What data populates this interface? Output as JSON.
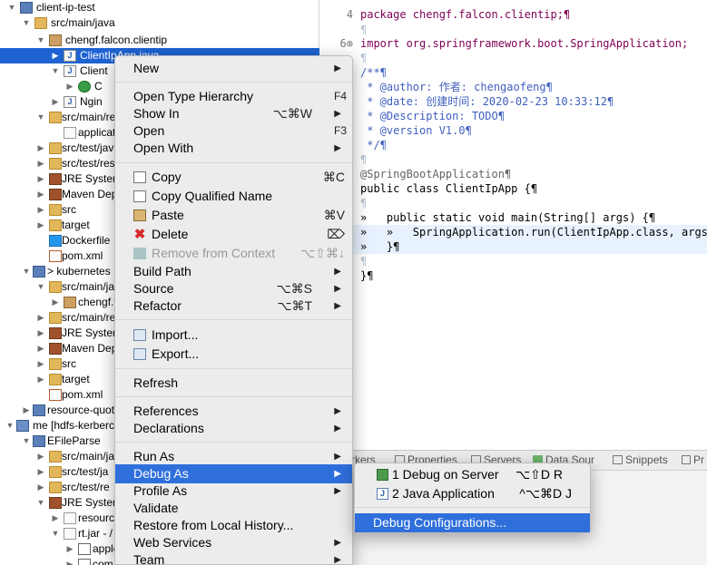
{
  "explorer": {
    "rows": [
      {
        "label": "client-ip-test",
        "expanded": true,
        "icon": "project-icon"
      },
      {
        "label": "src/main/java",
        "expanded": true,
        "icon": "source-folder-icon"
      },
      {
        "label": "chengf.falcon.clientip",
        "expanded": true,
        "icon": "package-icon"
      },
      {
        "label": "ClientIpApp.java",
        "expanded": false,
        "icon": "java-file-icon"
      },
      {
        "label": "Client",
        "expanded": true,
        "icon": "java-file-icon"
      },
      {
        "label": "C",
        "expanded": false,
        "icon": "class-icon"
      },
      {
        "label": "Ngin",
        "expanded": false,
        "icon": "java-file-icon"
      },
      {
        "label": "src/main/re",
        "expanded": true,
        "icon": "source-folder-icon"
      },
      {
        "label": "applicat",
        "expanded": false,
        "icon": "file-icon"
      },
      {
        "label": "src/test/jav",
        "expanded": false,
        "icon": "source-folder-icon"
      },
      {
        "label": "src/test/res",
        "expanded": false,
        "icon": "source-folder-icon"
      },
      {
        "label": "JRE System",
        "expanded": false,
        "icon": "library-icon"
      },
      {
        "label": "Maven Dep",
        "expanded": false,
        "icon": "library-icon"
      },
      {
        "label": "src",
        "expanded": false,
        "icon": "folder-icon"
      },
      {
        "label": "target",
        "expanded": false,
        "icon": "folder-icon"
      },
      {
        "label": "Dockerfile",
        "expanded": false,
        "icon": "docker-icon"
      },
      {
        "label": "pom.xml",
        "expanded": false,
        "icon": "maven-file-icon"
      },
      {
        "label": "> kubernetes",
        "expanded": true,
        "icon": "project-icon"
      },
      {
        "label": "src/main/ja",
        "expanded": true,
        "icon": "source-folder-icon"
      },
      {
        "label": "chengf.f",
        "expanded": false,
        "icon": "package-icon"
      },
      {
        "label": "src/main/re",
        "expanded": false,
        "icon": "source-folder-icon"
      },
      {
        "label": "JRE System",
        "expanded": false,
        "icon": "library-icon"
      },
      {
        "label": "Maven Dep",
        "expanded": false,
        "icon": "library-icon"
      },
      {
        "label": "src",
        "expanded": false,
        "icon": "folder-icon"
      },
      {
        "label": "target",
        "expanded": false,
        "icon": "folder-icon"
      },
      {
        "label": "pom.xml",
        "expanded": false,
        "icon": "maven-file-icon"
      },
      {
        "label": "resource-quot",
        "expanded": false,
        "icon": "project-icon"
      },
      {
        "label": "me [hdfs-kerberc",
        "expanded": true,
        "icon": "working-set-icon"
      },
      {
        "label": "EFileParse",
        "expanded": true,
        "icon": "project-icon"
      },
      {
        "label": "src/main/ja",
        "expanded": false,
        "icon": "source-folder-icon"
      },
      {
        "label": "src/test/ja",
        "expanded": false,
        "icon": "source-folder-icon"
      },
      {
        "label": "src/test/re",
        "expanded": false,
        "icon": "source-folder-icon"
      },
      {
        "label": "JRE System",
        "expanded": true,
        "icon": "library-icon"
      },
      {
        "label": "resource",
        "expanded": false,
        "icon": "jar-icon"
      },
      {
        "label": "rt.jar - /",
        "expanded": true,
        "icon": "jar-icon"
      },
      {
        "label": "apple",
        "expanded": false,
        "icon": "package-icon"
      },
      {
        "label": "com",
        "expanded": false,
        "icon": "package-icon"
      }
    ]
  },
  "editor": {
    "lines": [
      {
        "num": "4",
        "text": "package chengf.falcon.clientip;¶"
      },
      {
        "num": "",
        "text": "¶"
      },
      {
        "num": "6⊕",
        "text": "import org.springframework.boot.SpringApplication;"
      },
      {
        "num": "",
        "text": "¶"
      },
      {
        "num": "⊖",
        "text": "/**¶"
      },
      {
        "num": "",
        "text": " * @author: 作者: chengaofeng¶"
      },
      {
        "num": "",
        "text": " * @date: 创建时间: 2020-02-23 10:33:12¶"
      },
      {
        "num": "",
        "text": " * @Description: TODO¶"
      },
      {
        "num": "",
        "text": " * @version V1.0¶"
      },
      {
        "num": "",
        "text": " */¶"
      },
      {
        "num": "",
        "text": "¶"
      },
      {
        "num": "",
        "text": "@SpringBootApplication¶"
      },
      {
        "num": "",
        "text": "public class ClientIpApp {¶"
      },
      {
        "num": "",
        "text": "¶"
      },
      {
        "num": "⊖",
        "text": "»   public static void main(String[] args) {¶"
      },
      {
        "num": "",
        "text": "»   »   SpringApplication.run(ClientIpApp.class, args);"
      },
      {
        "num": "",
        "text": "»   }¶"
      },
      {
        "num": "",
        "text": "¶"
      },
      {
        "num": "",
        "text": "}¶"
      }
    ]
  },
  "views": {
    "tabs": [
      "rkers",
      "Properties",
      "Servers",
      "Data Sour",
      "Snippets",
      "Pr"
    ]
  },
  "context_menu": {
    "items": [
      {
        "label": "New",
        "shortcut": "",
        "submenu": true
      },
      {
        "label": "Open Type Hierarchy",
        "shortcut": "F4"
      },
      {
        "label": "Show In",
        "shortcut": "⌥⌘W",
        "submenu": true
      },
      {
        "label": "Open",
        "shortcut": "F3"
      },
      {
        "label": "Open With",
        "shortcut": "",
        "submenu": true
      },
      {
        "label": "Copy",
        "shortcut": "⌘C",
        "icon": "copy-icon"
      },
      {
        "label": "Copy Qualified Name",
        "shortcut": "",
        "icon": "copy-icon"
      },
      {
        "label": "Paste",
        "shortcut": "⌘V",
        "icon": "paste-icon"
      },
      {
        "label": "Delete",
        "shortcut": "⌦",
        "icon": "delete-icon"
      },
      {
        "label": "Remove from Context",
        "shortcut": "⌥⇧⌘↓",
        "icon": "remove-context-icon",
        "disabled": true
      },
      {
        "label": "Build Path",
        "shortcut": "",
        "submenu": true
      },
      {
        "label": "Source",
        "shortcut": "⌥⌘S",
        "submenu": true
      },
      {
        "label": "Refactor",
        "shortcut": "⌥⌘T",
        "submenu": true
      },
      {
        "label": "Import...",
        "shortcut": "",
        "icon": "import-icon"
      },
      {
        "label": "Export...",
        "shortcut": "",
        "icon": "export-icon"
      },
      {
        "label": "Refresh",
        "shortcut": ""
      },
      {
        "label": "References",
        "shortcut": "",
        "submenu": true
      },
      {
        "label": "Declarations",
        "shortcut": "",
        "submenu": true
      },
      {
        "label": "Run As",
        "shortcut": "",
        "submenu": true
      },
      {
        "label": "Debug As",
        "shortcut": "",
        "submenu": true,
        "active": true
      },
      {
        "label": "Profile As",
        "shortcut": "",
        "submenu": true
      },
      {
        "label": "Validate",
        "shortcut": ""
      },
      {
        "label": "Restore from Local History...",
        "shortcut": ""
      },
      {
        "label": "Web Services",
        "shortcut": "",
        "submenu": true
      },
      {
        "label": "Team",
        "shortcut": "",
        "submenu": true
      }
    ]
  },
  "debug_submenu": {
    "items": [
      {
        "label": "1 Debug on Server",
        "shortcut": "⌥⇧D R",
        "icon": "debug-server-icon"
      },
      {
        "label": "2 Java Application",
        "shortcut": "^⌥⌘D J",
        "icon": "java-app-icon"
      },
      {
        "label": "Debug Configurations...",
        "shortcut": "",
        "active": true
      }
    ]
  },
  "colors": {
    "selection": "#1e63d2",
    "menu_highlight": "#2f6fdc",
    "keyword": "#7f0055",
    "javadoc": "#3f5fbf"
  }
}
